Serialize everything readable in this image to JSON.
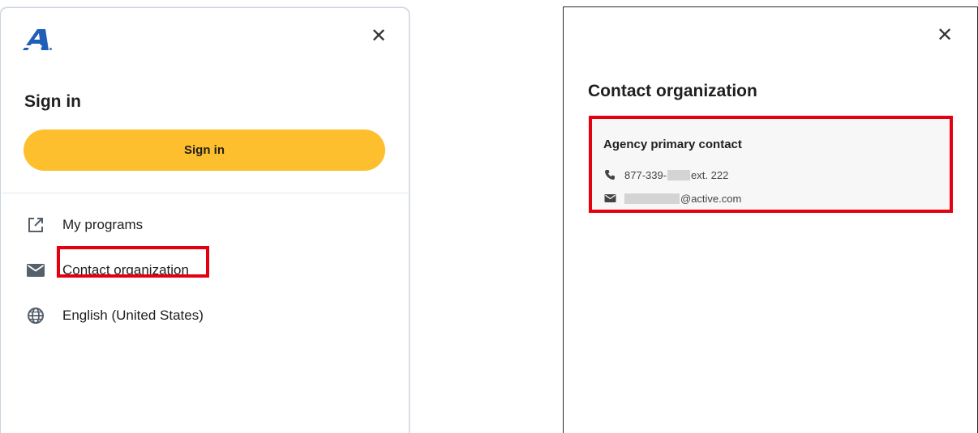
{
  "left_panel": {
    "close_glyph": "✕",
    "logo_icon": "active-logo",
    "title": "Sign in",
    "signin_button": "Sign in",
    "menu": [
      {
        "label": "My programs",
        "icon": "external-link-icon"
      },
      {
        "label": "Contact organization",
        "icon": "mail-icon"
      },
      {
        "label": "English (United States)",
        "icon": "globe-icon"
      }
    ]
  },
  "right_panel": {
    "close_glyph": "✕",
    "title": "Contact organization",
    "contact": {
      "heading": "Agency primary contact",
      "phone_prefix": "877-339-",
      "phone_suffix": "ext. 222",
      "email_suffix": "@active.com"
    }
  },
  "colors": {
    "accent_yellow": "#fdbf2d",
    "highlight_red": "#e4000f",
    "logo_blue": "#1f5fb8",
    "icon_gray": "#55606a"
  }
}
